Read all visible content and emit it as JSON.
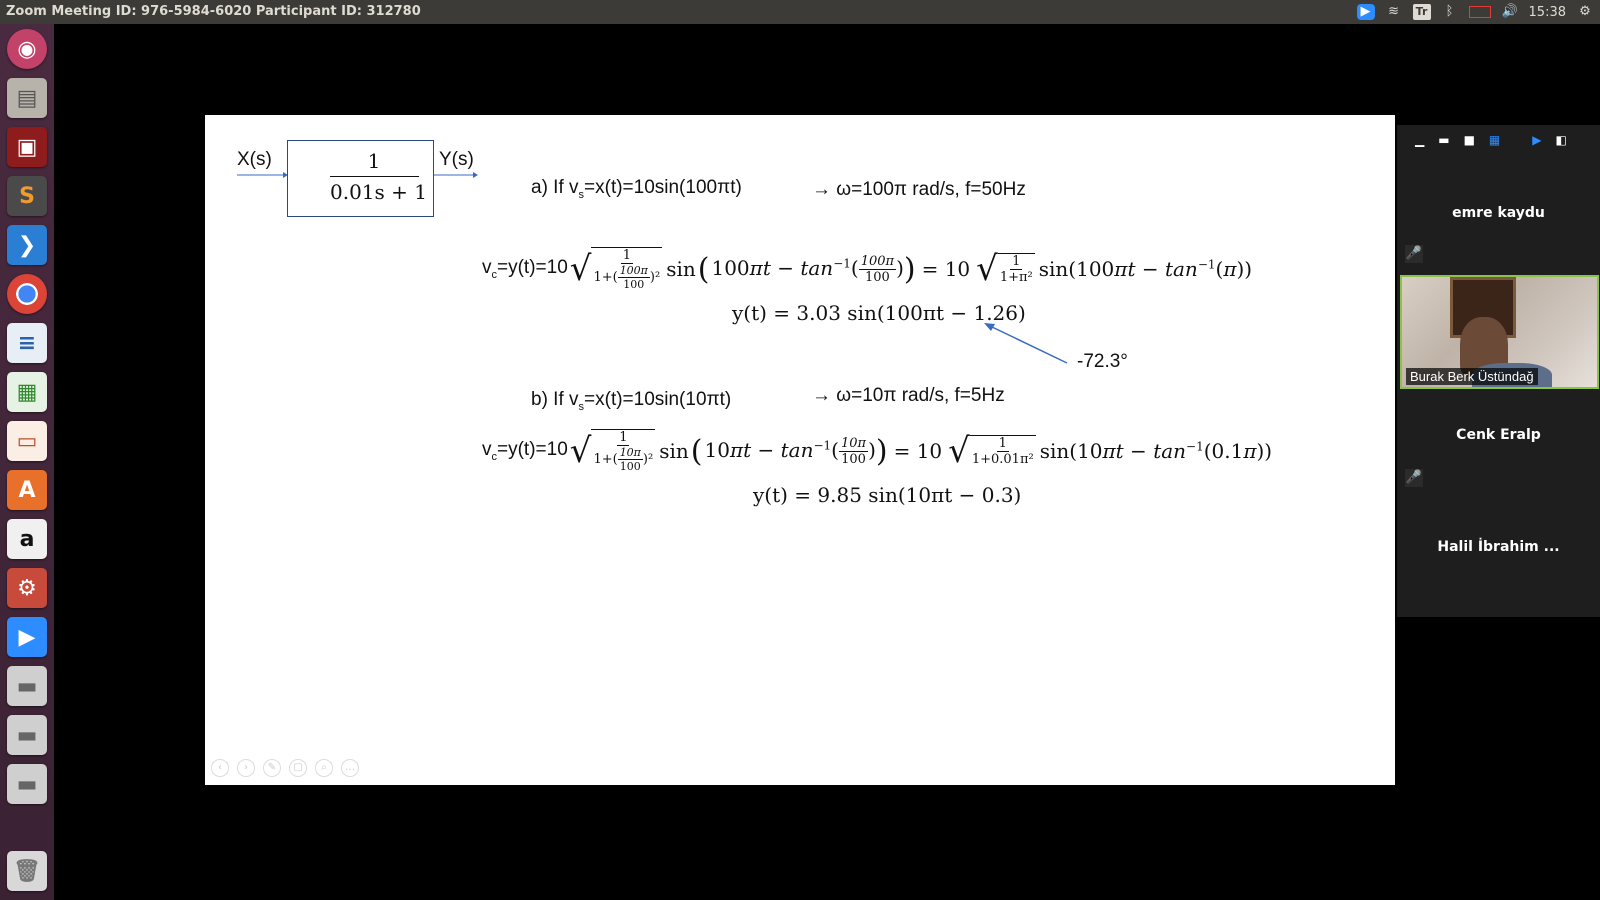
{
  "window": {
    "title": "Zoom Meeting ID: 976-5984-6020 Participant ID: 312780"
  },
  "tray": {
    "keyboard": "Tr",
    "time": "15:38"
  },
  "slide": {
    "block_input": "X(s)",
    "block_output": "Y(s)",
    "tf_num": "1",
    "tf_den": "0.01s + 1",
    "a_label": "a) If v",
    "a_rest": "=x(t)=10sin(100πt)",
    "a_omega": "→ ω=100π rad/s, f=50Hz",
    "a_eq_prefix": "=y(t)=10",
    "a_result": "y(t) = 3.03 sin(100πt − 1.26)",
    "a_angle": "-72.3°",
    "b_label": "b) If v",
    "b_rest": "=x(t)=10sin(10πt)",
    "b_omega": "→ ω=10π rad/s, f=5Hz",
    "b_eq_prefix": "=y(t)=10",
    "b_result": "y(t) = 9.85 sin(10πt − 0.3)",
    "sub_s": "s",
    "sub_c": "c"
  },
  "participants": [
    {
      "name": "emre kaydu"
    },
    {
      "name": "Burak Berk Üstündağ"
    },
    {
      "name": "Cenk Eralp"
    },
    {
      "name": "Halil İbrahim ..."
    }
  ],
  "colors": {
    "launcher": "#4a2a40",
    "topbar": "#3c3b37",
    "active_speaker": "#8bc34a",
    "arrow": "#3a6bc4"
  }
}
